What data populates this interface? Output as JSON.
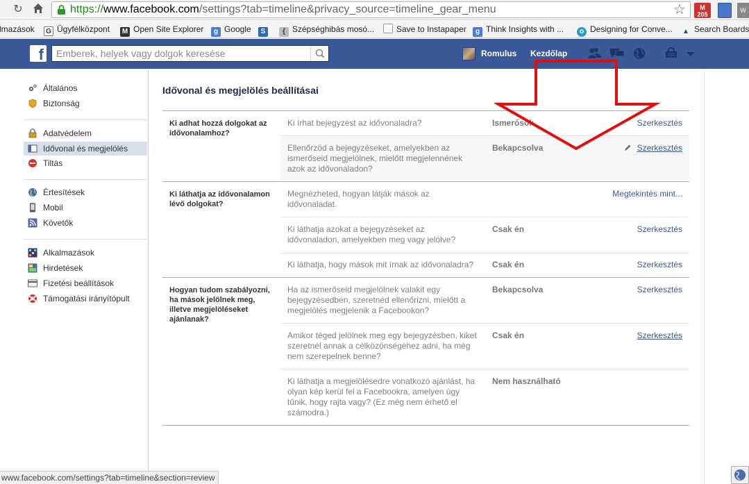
{
  "browser": {
    "url_scheme": "https://",
    "url_host": "www.facebook.com",
    "url_path": "/settings?tab=timeline&privacy_source=timeline_gear_menu",
    "gmail_count": "205",
    "ext_w_label": "W"
  },
  "bookmarks": [
    {
      "label": "lmazások"
    },
    {
      "label": "Ügyfélközpont"
    },
    {
      "label": "Open Site Explorer"
    },
    {
      "label": "Google"
    },
    {
      "label": ""
    },
    {
      "label": "Szépséghibás mosó..."
    },
    {
      "label": "Save to Instapaper"
    },
    {
      "label": "Think Insights with ..."
    },
    {
      "label": "Designing for Conve..."
    },
    {
      "label": "Search Boards f"
    }
  ],
  "header": {
    "search_placeholder": "Emberek, helyek vagy dolgok keresése",
    "username": "Romulus",
    "home_label": "Kezdőlap"
  },
  "leftnav": {
    "items": [
      {
        "label": "Általános"
      },
      {
        "label": "Biztonság"
      },
      {
        "label": "Adatvédelem"
      },
      {
        "label": "Idővonal és megjelölés"
      },
      {
        "label": "Tiltás"
      },
      {
        "label": "Értesítések"
      },
      {
        "label": "Mobil"
      },
      {
        "label": "Követők"
      },
      {
        "label": "Alkalmazások"
      },
      {
        "label": "Hirdetések"
      },
      {
        "label": "Fizetési beállítások"
      },
      {
        "label": "Támogatási irányítópult"
      }
    ]
  },
  "main": {
    "title": "Idővonal és megjelölés beállításai",
    "sections": [
      {
        "label": "Ki adhat hozzá dolgokat az idővonalamhoz?",
        "rows": [
          {
            "question": "Ki írhat bejegyzést az idővonaladra?",
            "value": "Ismerősök",
            "action": "Szerkesztés"
          },
          {
            "question": "Ellenőrzöd a bejegyzéseket, amelyekben az ismerőseid megjelölnek, mielőtt megjelennének azok az idővonaladon?",
            "value": "Bekapcsolva",
            "action": "Szerkesztés"
          }
        ]
      },
      {
        "label": "Ki láthatja az idővonalamon lévő dolgokat?",
        "rows": [
          {
            "question": "Megnézheted, hogyan látják mások az idővonaladat.",
            "value": "",
            "action": "Megtekintés mint..."
          },
          {
            "question": "Ki láthatja azokat a bejegyzéseket az idővonaladon, amelyekben meg vagy jelölve?",
            "value": "Csak én",
            "action": "Szerkesztés"
          },
          {
            "question": "Ki láthatja, hogy mások mit írnak az idővonaladra?",
            "value": "Csak én",
            "action": "Szerkesztés"
          }
        ]
      },
      {
        "label": "Hogyan tudom szabályozni, ha mások jelölnek meg, illetve megjelöléseket ajánlanak?",
        "rows": [
          {
            "question": "Ha az ismerőseid megjelölnek valakit egy bejegyzésedben, szeretnéd ellenőrizni, mielőtt a megjelölés megjelenik a Facebookon?",
            "value": "Bekapcsolva",
            "action": "Szerkesztés"
          },
          {
            "question": "Amikor téged jelölnek meg egy bejegyzésben, kiket szeretnél annak a célközönségéhez adni, ha még nem szerepelnek benne?",
            "value": "Csak én",
            "action": "Szerkesztés"
          },
          {
            "question": "Ki láthatja a megjelölésedre vonatkozó ajánlást, ha olyan kép kerül fel a Facebookra, amelyen úgy tűnik, hogy rajta vagy? (Ez még nem érhető el számodra.)",
            "value": "Nem használható",
            "action": ""
          }
        ]
      }
    ]
  },
  "statusbar": {
    "text": "www.facebook.com/settings?tab=timeline&section=review"
  },
  "colors": {
    "fb_blue": "#3b5998",
    "arrow_red": "#e01010"
  }
}
